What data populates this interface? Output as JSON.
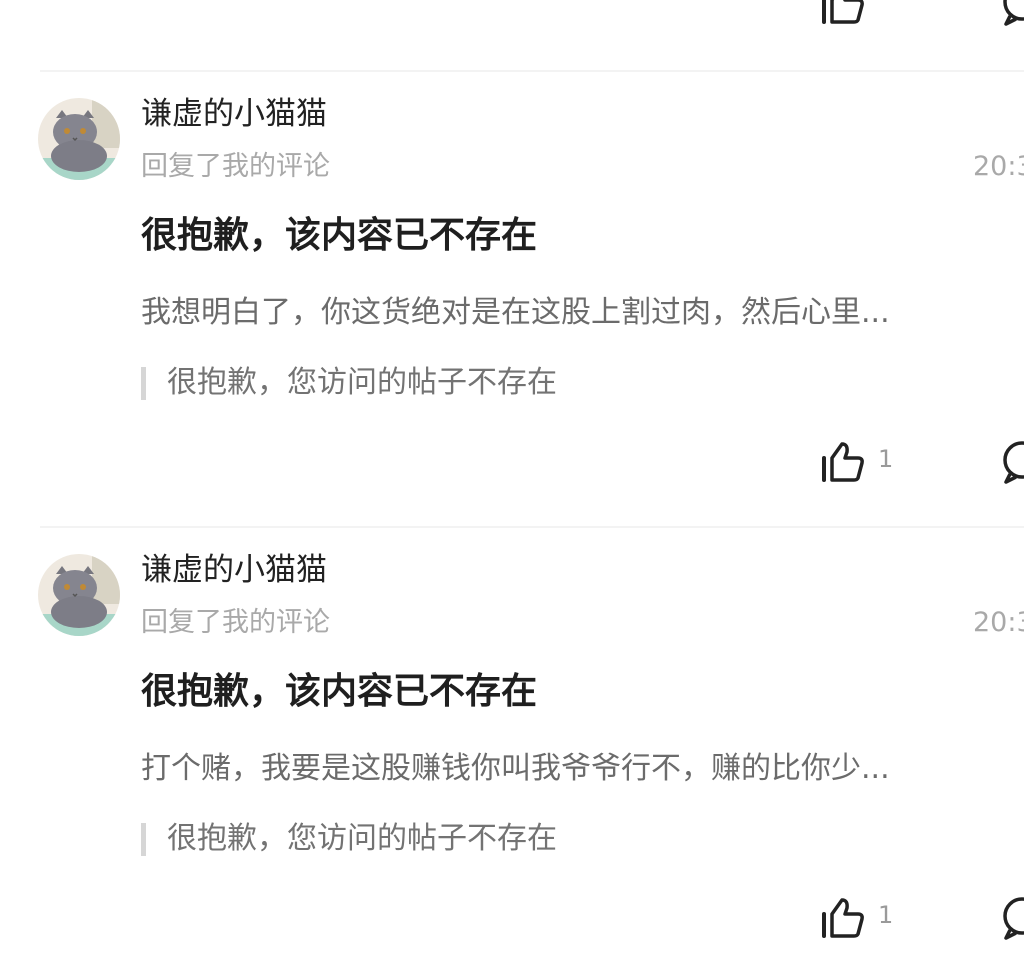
{
  "icons": {
    "like": "thumbs-up-icon",
    "comment": "comment-icon"
  },
  "comments": [
    {
      "user_name": "谦虚的小猫猫",
      "action": "回复了我的评论",
      "time": "20:3",
      "main_text": "很抱歉，该内容已不存在",
      "reply_text": "我想明白了，你这货绝对是在这股上割过肉，然后心里...",
      "quote_text": "很抱歉，您访问的帖子不存在",
      "like_count": "1"
    },
    {
      "user_name": "谦虚的小猫猫",
      "action": "回复了我的评论",
      "time": "20:3",
      "main_text": "很抱歉，该内容已不存在",
      "reply_text": "打个赌，我要是这股赚钱你叫我爷爷行不，赚的比你少...",
      "quote_text": "很抱歉，您访问的帖子不存在",
      "like_count": "1"
    }
  ]
}
